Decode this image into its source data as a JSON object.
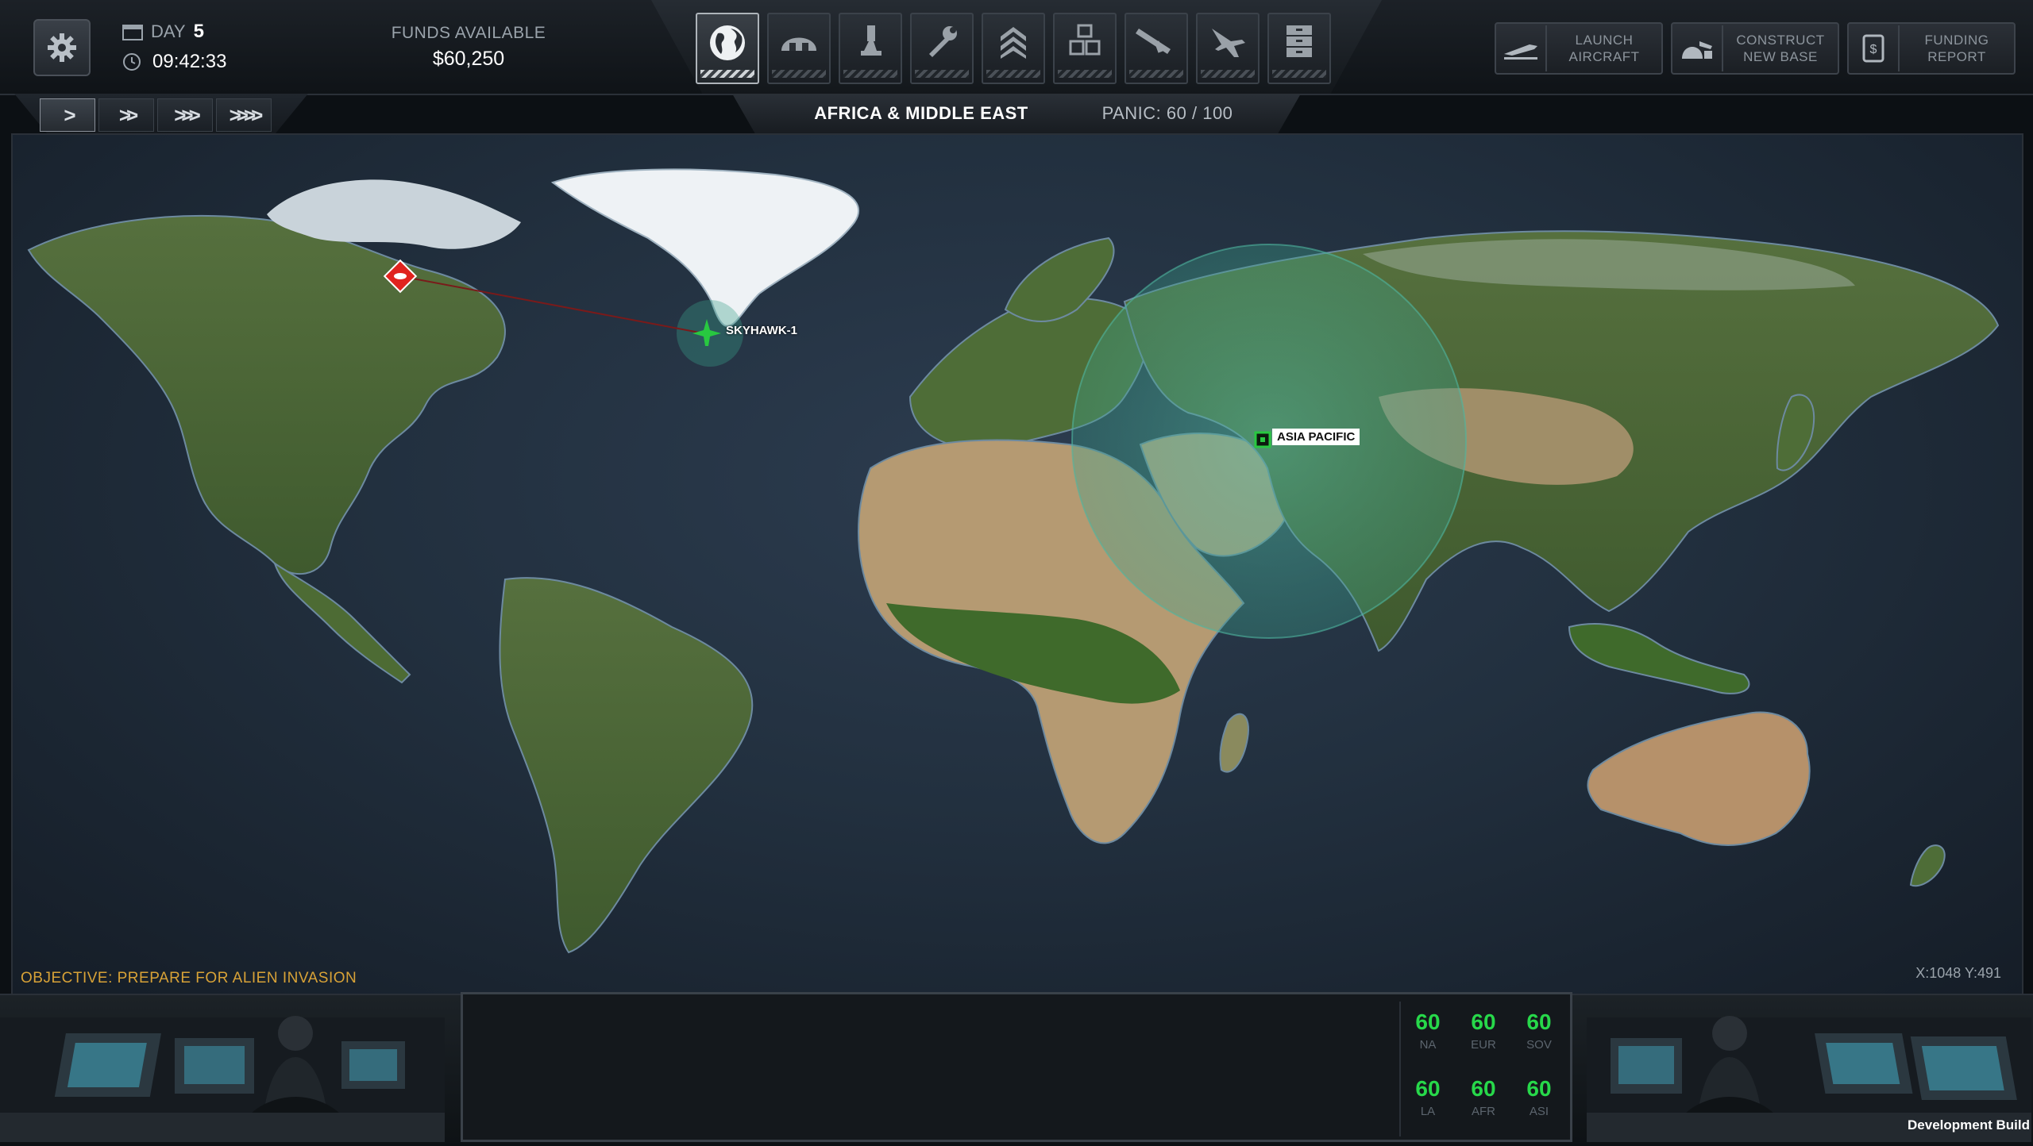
{
  "header": {
    "day_label": "DAY",
    "day_value": "5",
    "time": "09:42:33",
    "funds_label": "FUNDS AVAILABLE",
    "funds_value": "$60,250"
  },
  "speed_controls": [
    ">",
    ">>",
    ">>>",
    ">>>>"
  ],
  "nav_tabs": [
    {
      "icon": "globe-icon",
      "active": true
    },
    {
      "icon": "hangar-icon",
      "active": false
    },
    {
      "icon": "research-icon",
      "active": false
    },
    {
      "icon": "engineering-icon",
      "active": false
    },
    {
      "icon": "rank-icon",
      "active": false
    },
    {
      "icon": "storage-icon",
      "active": false
    },
    {
      "icon": "weapon-icon",
      "active": false
    },
    {
      "icon": "aircraft-icon",
      "active": false
    },
    {
      "icon": "archive-icon",
      "active": false
    }
  ],
  "region_bar": {
    "region": "AFRICA & MIDDLE EAST",
    "panic": "PANIC: 60 / 100"
  },
  "actions": [
    {
      "label": "LAUNCH\nAIRCRAFT",
      "icon": "aircraft-launch-icon"
    },
    {
      "label": "CONSTRUCT\nNEW BASE",
      "icon": "construct-base-icon"
    },
    {
      "label": "FUNDING\nREPORT",
      "icon": "funding-report-icon"
    }
  ],
  "map": {
    "aircraft_label": "SKYHAWK-1",
    "base_label": "ASIA PACIFIC",
    "objective": "OBJECTIVE: PREPARE FOR ALIEN INVASION",
    "cursor_coords": "X:1048 Y:491",
    "colors": {
      "ocean": "#22303f",
      "land": "#4a6a35",
      "desert": "#b59a72",
      "ice": "#e8eef2",
      "radar": "#3aa08a",
      "ufo": "#e0231e",
      "aircraft": "#28c840"
    }
  },
  "panic_grid": [
    {
      "value": "60",
      "code": "NA"
    },
    {
      "value": "60",
      "code": "EUR"
    },
    {
      "value": "60",
      "code": "SOV"
    },
    {
      "value": "60",
      "code": "LA"
    },
    {
      "value": "60",
      "code": "AFR"
    },
    {
      "value": "60",
      "code": "ASI"
    }
  ],
  "footer": {
    "dev_build": "Development Build"
  }
}
